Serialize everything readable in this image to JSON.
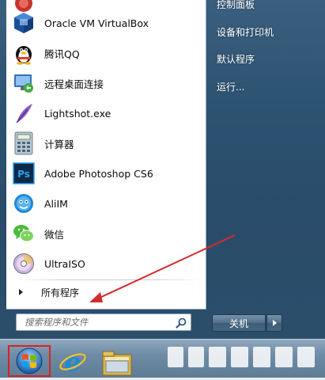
{
  "start_menu": {
    "programs": [
      {
        "name": "top-partial-program",
        "label": "",
        "icon": "generic-app-icon"
      },
      {
        "name": "oracle-vm-virtualbox",
        "label": "Oracle VM VirtualBox",
        "icon": "virtualbox-icon"
      },
      {
        "name": "tencent-qq",
        "label": "腾讯QQ",
        "icon": "qq-penguin-icon"
      },
      {
        "name": "remote-desktop",
        "label": "远程桌面连接",
        "icon": "remote-desktop-icon"
      },
      {
        "name": "lightshot",
        "label": "Lightshot.exe",
        "icon": "feather-icon"
      },
      {
        "name": "calculator",
        "label": "计算器",
        "icon": "calculator-icon"
      },
      {
        "name": "adobe-photoshop-cs6",
        "label": "Adobe Photoshop CS6",
        "icon": "photoshop-icon",
        "icon_text": "Ps"
      },
      {
        "name": "aliim",
        "label": "AliIM",
        "icon": "aliim-icon"
      },
      {
        "name": "wechat",
        "label": "微信",
        "icon": "wechat-icon"
      },
      {
        "name": "ultraiso",
        "label": "UltraISO",
        "icon": "disc-icon"
      }
    ],
    "all_programs_label": "所有程序",
    "search": {
      "placeholder": "搜索程序和文件",
      "value": ""
    },
    "right_pane": [
      {
        "name": "control-panel",
        "label": "控制面板"
      },
      {
        "name": "devices-and-printers",
        "label": "设备和打印机"
      },
      {
        "name": "default-programs",
        "label": "默认程序"
      },
      {
        "name": "run",
        "label": "运行..."
      }
    ],
    "shutdown_label": "关机"
  },
  "colors": {
    "start_button_highlight": "#d6231f",
    "annotation_arrow": "#d32b2b",
    "photoshop_blue": "#2aa2f2"
  }
}
